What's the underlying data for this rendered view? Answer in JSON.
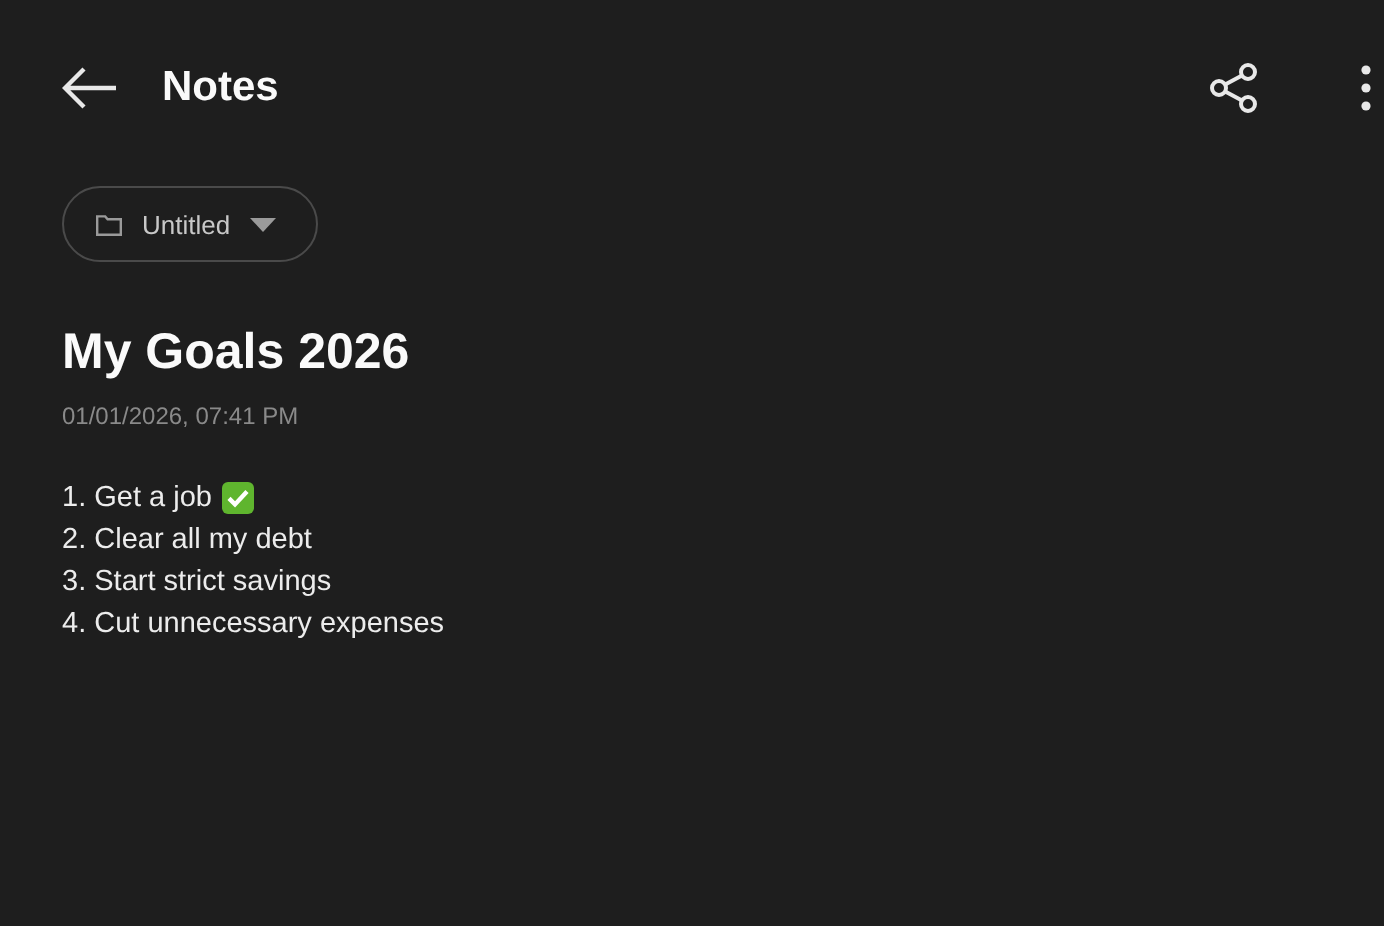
{
  "header": {
    "title": "Notes"
  },
  "folder": {
    "label": "Untitled"
  },
  "note": {
    "title": "My Goals 2026",
    "timestamp": "01/01/2026, 07:41 PM",
    "lines": [
      {
        "text": "1. Get a job",
        "done": true
      },
      {
        "text": "2. Clear all my debt",
        "done": false
      },
      {
        "text": "3. Start strict savings",
        "done": false
      },
      {
        "text": "4. Cut unnecessary expenses",
        "done": false
      }
    ]
  }
}
